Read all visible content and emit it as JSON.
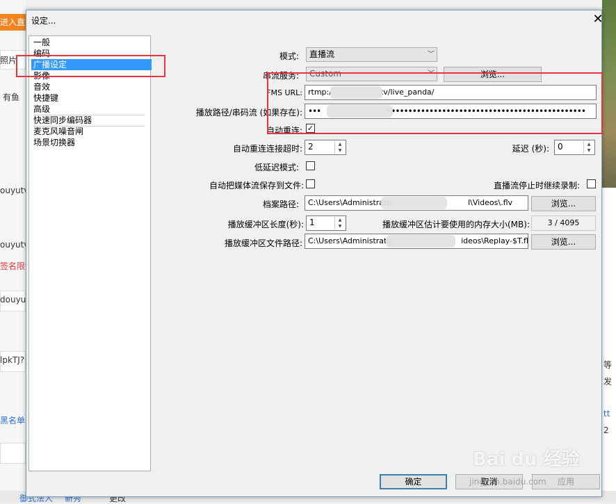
{
  "background": {
    "enter_room_label": "进入直",
    "left_texts": [
      "照片",
      "有鱼",
      "ouyutv.",
      "ouyutv.",
      "签名限制",
      "douyu",
      "lpkTJ?",
      "黑名单"
    ],
    "bottom_texts": [
      "御式法人",
      "新秀",
      "更改"
    ],
    "right_texts": [
      "等",
      "发",
      "tt",
      "2"
    ]
  },
  "dialog": {
    "title": "设定...",
    "nav_items": [
      "一般",
      "编码",
      "广播设定",
      "影像",
      "音效",
      "快捷键",
      "高级",
      "快速同步编码器",
      "麦克风噪音闸",
      "场景切换器"
    ],
    "selected_nav": "广播设定",
    "mode_label": "模式:",
    "mode_value": "直播流",
    "service_label": "串流服务:",
    "service_value": "Custom",
    "browse_label": "浏览...",
    "fms_label": "FMS URL:",
    "fms_value": "rtmp:/",
    "fms_value_tail": "tv/live_panda/",
    "playpath_label": "播放路径/串码流 (如果存在):",
    "playpath_value": "•••",
    "playpath_value_tail": "•••••••••••••••••••••••••••••••••••••••••••••••",
    "auto_reconnect_label": "自动重连:",
    "auto_reconnect_checked": "✓",
    "reconnect_timeout_label": "自动重连连接超时:",
    "reconnect_timeout_value": "2",
    "delay_label": "延迟 (秒):",
    "delay_value": "0",
    "low_latency_label": "低延迟模式:",
    "save_stream_label": "自动把媒体流保存到文件:",
    "continue_record_label": "直播流停止时继续录制:",
    "file_path_label": "档案路径:",
    "file_path_value": "C:\\Users\\Administrato",
    "file_path_tail": "l\\Videos\\.flv",
    "buffer_len_label": "播放缓冲区长度(秒):",
    "buffer_len_value": "1",
    "buffer_mem_label": "播放缓冲区估计要使用的内存大小(MB):",
    "buffer_mem_value": "3 / 4095",
    "buffer_path_label": "播放缓冲区文件路径:",
    "buffer_path_value": "C:\\Users\\Administrato",
    "buffer_path_tail": "ideos\\Replay-$T.flv",
    "ok_label": "确定",
    "cancel_label": "取消",
    "apply_label": "应用"
  },
  "watermark": {
    "text": "Bai du 经验",
    "sub": "jingyan.baidu.com"
  },
  "colors": {
    "highlight": "#e8343d",
    "selection": "#3399ff"
  }
}
